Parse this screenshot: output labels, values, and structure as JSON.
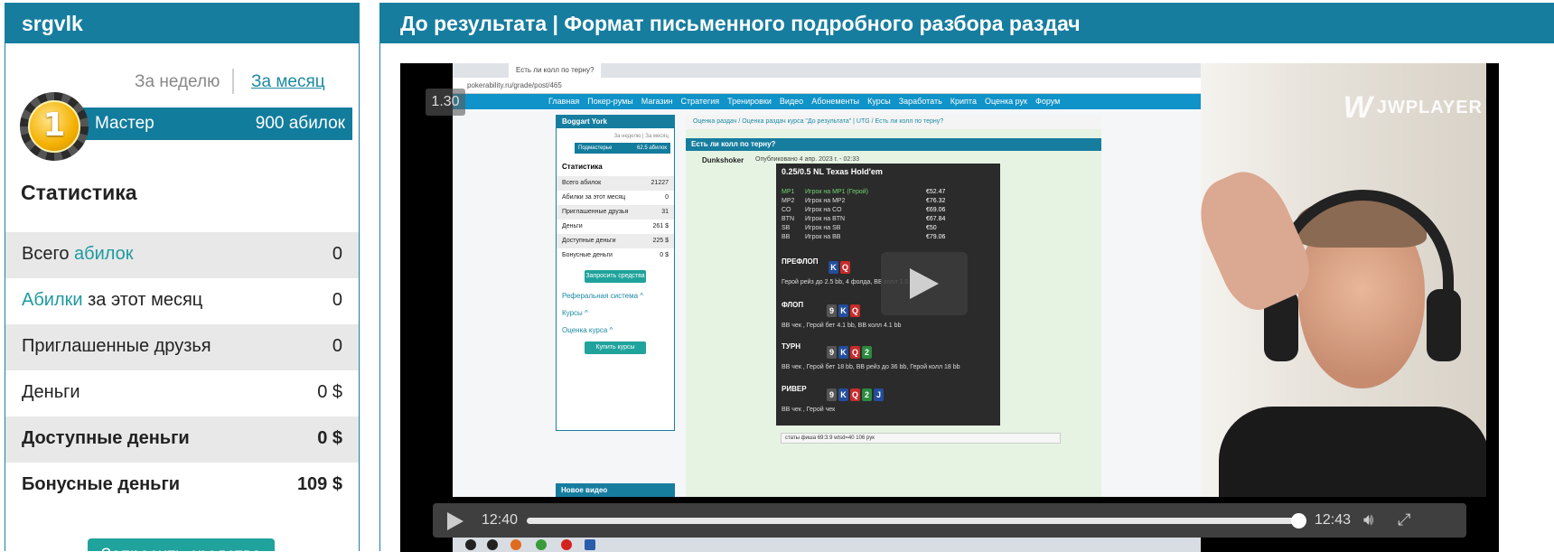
{
  "left_panel": {
    "username": "srgvlk",
    "tabs": {
      "week": "За неделю",
      "month": "За месяц"
    },
    "rank": {
      "medal_digit": "1",
      "title": "Мастер",
      "points": "900 абилок"
    },
    "stats_title": "Статистика",
    "stats": [
      {
        "label_pre": "Всего ",
        "label_accent": "абилок",
        "label_post": "",
        "value": "0"
      },
      {
        "label_pre": "",
        "label_accent": "Абилки",
        "label_post": " за этот месяц",
        "value": "0"
      },
      {
        "label_pre": "Приглашенные друзья",
        "label_accent": "",
        "label_post": "",
        "value": "0"
      },
      {
        "label_pre": "Деньги",
        "label_accent": "",
        "label_post": "",
        "value": "0 $"
      },
      {
        "label_pre": "Доступные деньги",
        "label_accent": "",
        "label_post": "",
        "value": "0 $"
      },
      {
        "label_pre": "Бонусные деньги",
        "label_accent": "",
        "label_post": "",
        "value": "109 $"
      }
    ],
    "request_button": "Запросить средства"
  },
  "right_panel": {
    "title": "До результата | Формат письменного подробного разбора раздач"
  },
  "player": {
    "brand": "JWPLAYER",
    "speed": "1.30",
    "time_current": "12:40",
    "time_total": "12:43",
    "progress": 0.996,
    "icons": {
      "play": "play-icon",
      "volume": "volume-icon",
      "fullscreen": "fullscreen-icon"
    }
  },
  "video_frame": {
    "browser": {
      "tab_title": "Есть ли колл по терну?",
      "url": "pokerability.ru/grade/post/465",
      "nav": [
        "Главная",
        "Покер-румы",
        "Магазин",
        "Стратегия",
        "Тренировки",
        "Видео",
        "Абонементы",
        "Курсы",
        "Заработать",
        "Крипта",
        "Оценка рук",
        "Форум"
      ]
    },
    "sidebar": {
      "user": "Boggart York",
      "tabs": "За неделю | За месяц",
      "rank": "Подмастерье",
      "rank_points": "62.5 абилок",
      "stats_title": "Статистика",
      "rows": [
        {
          "label": "Всего абилок",
          "value": "21227"
        },
        {
          "label": "Абилки за этот месяц",
          "value": "0"
        },
        {
          "label": "Приглашенные друзья",
          "value": "31"
        },
        {
          "label": "Деньги",
          "value": "261 $"
        },
        {
          "label": "Доступные деньги",
          "value": "225 $"
        },
        {
          "label": "Бонусные деньги",
          "value": "0 $"
        }
      ],
      "button": "Запросить средства",
      "links": [
        "Реферальная система ^",
        "Курсы ^",
        "Оценка курса ^"
      ],
      "buy_button": "Купить курсы",
      "new_video": "Новое видео"
    },
    "post": {
      "breadcrumb": "Оценка раздач / Оценка раздач курса \"До результата\" | UTG / Есть ли колл по терну?",
      "title": "Есть ли колл по терну?",
      "author": "Dunkshoker",
      "date": "Опубликовано 4 апр. 2023 г. - 02:33",
      "hand_title": "0.25/0.5 NL Texas Hold'em",
      "players": [
        {
          "pos": "MP1",
          "name": "Игрок на MP1 (Герой)",
          "stack": "€52.47"
        },
        {
          "pos": "MP2",
          "name": "Игрок на MP2",
          "stack": "€76.32"
        },
        {
          "pos": "CO",
          "name": "Игрок на CO",
          "stack": "€69.06"
        },
        {
          "pos": "BTN",
          "name": "Игрок на BTN",
          "stack": "€67.84"
        },
        {
          "pos": "SB",
          "name": "Игрок на SB",
          "stack": "€50"
        },
        {
          "pos": "BB",
          "name": "Игрок на BB",
          "stack": "€79.06"
        }
      ],
      "streets": [
        {
          "name": "ПРЕФЛОП",
          "cards": [
            "K",
            "Q"
          ],
          "action": "Герой рейз до 2.5 bb, 4 фолда, BB колл 1.5 bb"
        },
        {
          "name": "ФЛОП",
          "cards": [
            "9",
            "K",
            "Q"
          ],
          "action": "BB чек , Герой бет 4.1 bb, BB колл 4.1 bb"
        },
        {
          "name": "ТУРН",
          "cards": [
            "9",
            "K",
            "Q",
            "2"
          ],
          "action": "BB чек , Герой бет 18 bb, BB рейз до 36 bb, Герой колл 18 bb"
        },
        {
          "name": "РИВЕР",
          "cards": [
            "9",
            "K",
            "Q",
            "2",
            "J"
          ],
          "action": "BB чек , Герой чек"
        }
      ],
      "footer": "статы фиша 69:3.9 wtsd=40 106 рук"
    }
  }
}
